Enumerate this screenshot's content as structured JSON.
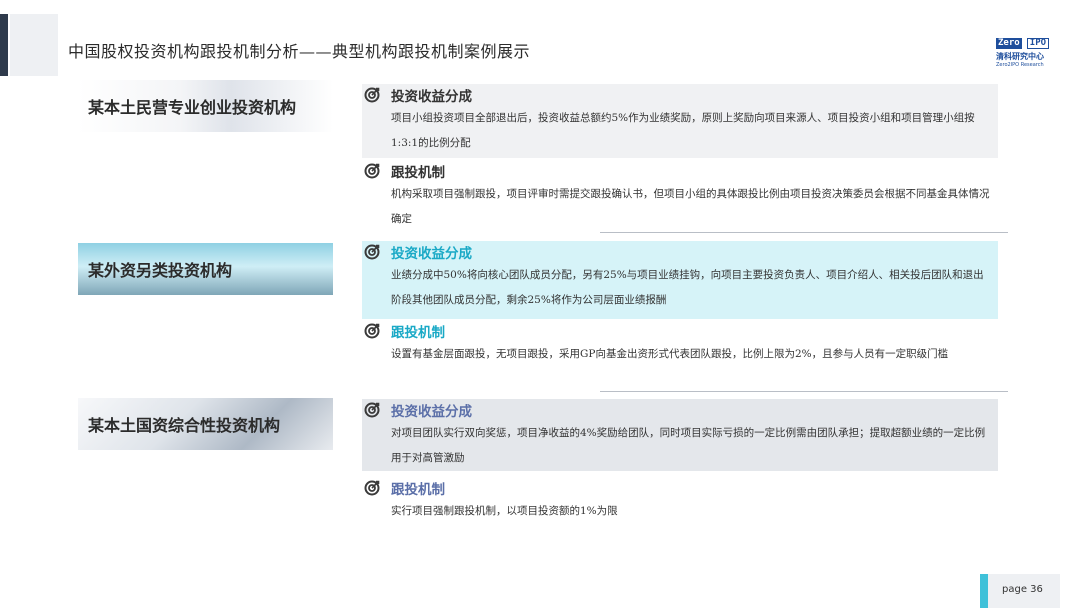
{
  "header": {
    "title": "中国股权投资机构跟投机制分析——典型机构跟投机制案例展示",
    "logo_line1a": "Zero",
    "logo_line1b": "IPO",
    "logo_cn": "清科研究中心",
    "logo_en": "Zero2IPO Research"
  },
  "categories": [
    {
      "label": "某本土民营专业创业投资机构"
    },
    {
      "label": "某外资另类投资机构"
    },
    {
      "label": "某本土国资综合性投资机构"
    }
  ],
  "sections": [
    {
      "title": "投资收益分成",
      "text": "项目小组投资项目全部退出后，投资收益总额约5%作为业绩奖励，原则上奖励向项目来源人、项目投资小组和项目管理小组按1:3:1的比例分配"
    },
    {
      "title": "跟投机制",
      "text": "机构采取项目强制跟投，项目评审时需提交跟投确认书，但项目小组的具体跟投比例由项目投资决策委员会根据不同基金具体情况确定"
    },
    {
      "title": "投资收益分成",
      "text": "业绩分成中50%将向核心团队成员分配，另有25%与项目业绩挂钩，向项目主要投资负责人、项目介绍人、相关投后团队和退出阶段其他团队成员分配，剩余25%将作为公司层面业绩报酬"
    },
    {
      "title": "跟投机制",
      "text": "设置有基金层面跟投，无项目跟投，采用GP向基金出资形式代表团队跟投，比例上限为2%，且参与人员有一定职级门槛"
    },
    {
      "title": "投资收益分成",
      "text": "对项目团队实行双向奖惩，项目净收益的4%奖励给团队，同时项目实际亏损的一定比例需由团队承担；提取超额业绩的一定比例用于对高管激励"
    },
    {
      "title": "跟投机制",
      "text": "实行项目强制跟投机制，以项目投资额的1%为限"
    }
  ],
  "footer": {
    "page": "page  36"
  },
  "colors": {
    "accent_cyan": "#1aa9c6",
    "accent_blue": "#5b6fa8",
    "dark": "#2f3b4c"
  }
}
